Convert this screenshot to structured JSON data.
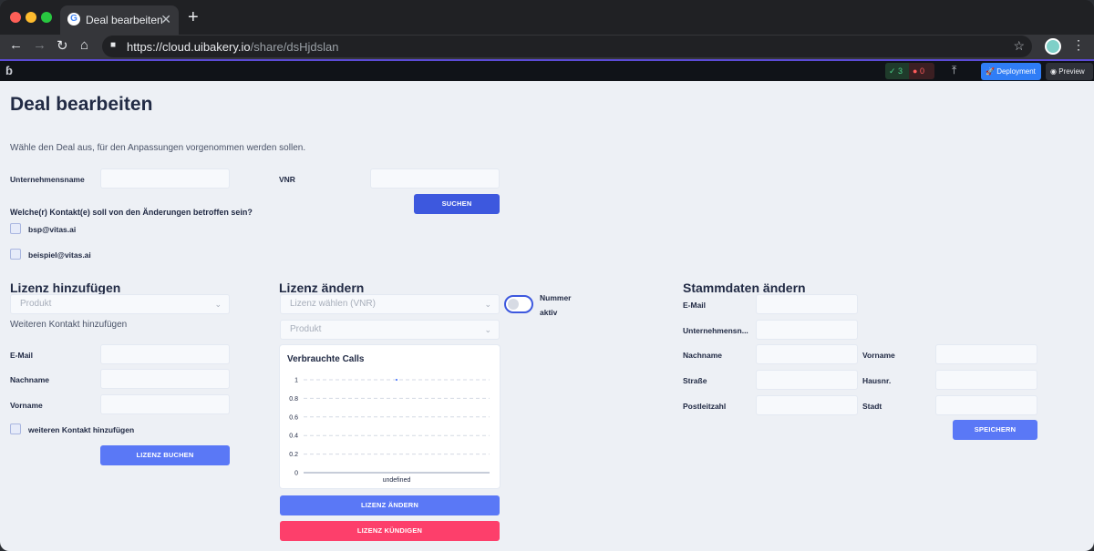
{
  "browser": {
    "tab_title": "Deal bearbeiten",
    "tab_favicon_letter": "G",
    "url_host": "https://cloud.uibakery.io",
    "url_path": "/share/dsHjdslan"
  },
  "appbar": {
    "ok_count": "3",
    "error_count": "0",
    "deployment_label": "Deployment",
    "preview_label": "Preview"
  },
  "page": {
    "title": "Deal bearbeiten",
    "intro": "Wähle den Deal aus, für den Anpassungen vorgenommen werden sollen.",
    "company_label": "Unternehmensname",
    "vnr_label": "VNR",
    "search_button": "SUCHEN",
    "contacts_question": "Welche(r) Kontakt(e) soll von den Änderungen betroffen sein?",
    "contacts": [
      "bsp@vitas.ai",
      "beispiel@vitas.ai"
    ]
  },
  "add_license": {
    "title": "Lizenz hinzufügen",
    "product_placeholder": "Produkt",
    "add_contact_text": "Weiteren Kontakt hinzufügen",
    "email_label": "E-Mail",
    "lastname_label": "Nachname",
    "firstname_label": "Vorname",
    "more_contact_checkbox": "weiteren Kontakt hinzufügen",
    "book_button": "LIZENZ BUCHEN"
  },
  "change_license": {
    "title": "Lizenz ändern",
    "license_placeholder": "Lizenz wählen (VNR)",
    "product_placeholder": "Produkt",
    "toggle_label_line1": "Nummer",
    "toggle_label_line2": "aktiv",
    "change_button": "LIZENZ ÄNDERN",
    "cancel_button": "LIZENZ KÜNDIGEN"
  },
  "master_data": {
    "title": "Stammdaten ändern",
    "email_label": "E-Mail",
    "company_label": "Unternehmensn...",
    "lastname_label": "Nachname",
    "firstname_label": "Vorname",
    "street_label": "Straße",
    "houseno_label": "Hausnr.",
    "zip_label": "Postleitzahl",
    "city_label": "Stadt",
    "save_button": "SPEICHERN"
  },
  "chart_data": {
    "type": "line",
    "title": "Verbrauchte Calls",
    "categories": [
      "undefined"
    ],
    "series": [
      {
        "values": [
          1
        ]
      }
    ],
    "yticks": [
      "1",
      "0.8",
      "0.6",
      "0.4",
      "0.2",
      "0"
    ],
    "ylim": [
      0,
      1
    ],
    "grid": true,
    "xlabel": "",
    "ylabel": ""
  }
}
